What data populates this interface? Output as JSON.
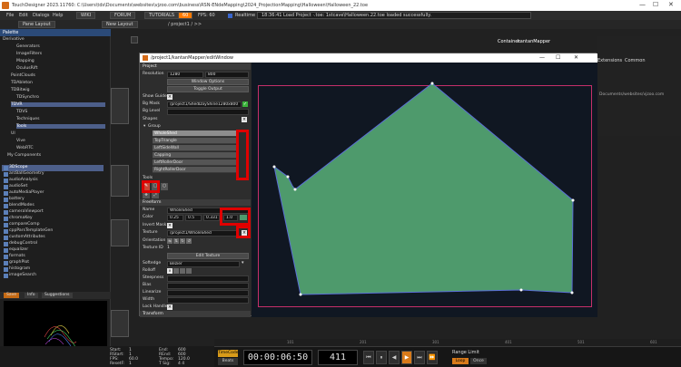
{
  "titlebar": {
    "text": "TouchDesigner 2023.11760: C:\\Users\\tds\\Documents\\websites\\vjzoo.com\\business\\RSN-ENdeMapping\\2024_ProjectionMapping\\Halloween\\Halloween_22.toe",
    "minimize": "—",
    "maximize": "☐",
    "close": "✕"
  },
  "menubar": {
    "items": [
      "File",
      "Edit",
      "Dialogs",
      "Help"
    ],
    "tabs": [
      "WIKI",
      "FORUM",
      "TUTORIALS"
    ],
    "fps_badge": "60",
    "fps_label": "FPS: 60",
    "realtime": "Realtime",
    "log": "18:36:41 Load Project ·.toe: 1stcave\\Halloween.22.toe loaded successfully."
  },
  "pathbar": {
    "pane_layout": "Pane Layout",
    "new_layout": "New Layout",
    "path": "/ project1 / >>"
  },
  "palette": {
    "title": "Palette",
    "tree": [
      {
        "label": "Derivative",
        "indent": 0
      },
      {
        "label": "Generators",
        "indent": 2
      },
      {
        "label": "ImageFilters",
        "indent": 2
      },
      {
        "label": "Mapping",
        "indent": 2
      },
      {
        "label": "OculusRift",
        "indent": 2
      },
      {
        "label": "PointClouds",
        "indent": 1
      },
      {
        "label": "TDAbleton",
        "indent": 1
      },
      {
        "label": "TDBitwig",
        "indent": 1
      },
      {
        "label": "TDSynchro",
        "indent": 2
      },
      {
        "label": "TDVR",
        "indent": 1
      },
      {
        "label": "TDVS",
        "indent": 2
      },
      {
        "label": "Techniques",
        "indent": 2
      },
      {
        "label": "Tools",
        "indent": 2
      },
      {
        "label": "UI",
        "indent": 1
      },
      {
        "label": "Vive",
        "indent": 2
      },
      {
        "label": "WebRTC",
        "indent": 2
      },
      {
        "label": "My Components",
        "indent": 0
      }
    ],
    "list": [
      "3DScope",
      "arcBallGeometry",
      "audioAnalysis",
      "audioSet",
      "autoMediaPlayer",
      "battery",
      "blendModes",
      "cameraViewport",
      "chromaKey",
      "compareComp",
      "cppParsTemplateGen",
      "customAttributes",
      "debugControl",
      "equalizer",
      "formats",
      "graphPlot",
      "histogram",
      "imageSearch"
    ],
    "tabs": [
      "Save",
      "Info",
      "Suggestions"
    ]
  },
  "window": {
    "title": "/project1/kantanMapper/editWindow",
    "minimize": "—",
    "maximize": "☐",
    "close": "✕",
    "project_label": "Project",
    "resolution_label": "Resolution",
    "res_w": "1280",
    "res_h": "800",
    "window_options": "Window Options",
    "toggle_output": "Toggle Output",
    "show_guide": "Show Guide",
    "bg_mask_label": "Bg Mask",
    "bg_mask_value": "/project1/ShedDayShine1280x800",
    "bg_level_label": "Bg Level",
    "shapes_label": "Shapes",
    "group_label": "Group",
    "shapes": [
      "WholeShed",
      "TopTriangle",
      "LeftSideWall",
      "Capping",
      "LeftRollerDoor",
      "RightRollerDoor"
    ],
    "tools_label": "Tools",
    "freeform_label": "Freeform",
    "name_label": "Name",
    "name_value": "WholeShed",
    "color_label": "Color",
    "color_r": "0.25",
    "color_g": "0.5",
    "color_b": "0.331",
    "color_a": "1.0",
    "invert_mask": "Invert Mask",
    "texture_label": "Texture",
    "texture_value": "/project1/WholeShed",
    "orientation_label": "Orientation",
    "texture_id_label": "Texture ID",
    "texture_id_value": "1",
    "edit_texture": "Edit Texture",
    "softedge_label": "Softedge",
    "softedge_value": "Bezier",
    "rolloff_label": "Rolloff",
    "steepness_label": "Steepness",
    "bias_label": "Bias",
    "linearize_label": "Linearize",
    "width_label": "Width",
    "lock_handles": "Lock Handles",
    "transform_label": "Transform"
  },
  "right_panel": {
    "container": "Container",
    "container_name": "kantanMapper",
    "tabs": [
      "Extensions",
      "Common"
    ],
    "path_text": "Documents/websites/vjzoo.com"
  },
  "timeline": {
    "start_label": "Start:",
    "start_value": "1",
    "end_label": "End:",
    "end_value": "600",
    "rstart_label": "RStart:",
    "rstart_value": "1",
    "rend_label": "REnd:",
    "rend_value": "600",
    "fps_label": "FPS:",
    "fps_value": "60.0",
    "tempo_label": "Tempo:",
    "tempo_value": "120.0",
    "reset_label": "ResetF:",
    "reset_value": "1",
    "tsig_label": "T Sig:",
    "tsig_value": "4   4",
    "timecode_label": "TimeCode",
    "beats_label": "Beats",
    "timecode": "00:00:06:50",
    "frame": "411",
    "range_limit": "Range Limit",
    "loop": "Loop",
    "once": "Once",
    "ruler": [
      "101",
      "201",
      "301",
      "401",
      "501",
      "601"
    ]
  },
  "colors": {
    "shape_fill": "#4e9a6c",
    "shape_stroke": "#5a6fd6",
    "highlight_red": "#e00000",
    "fps_orange": "#ff7a00",
    "palette_header": "#2b4a78"
  }
}
